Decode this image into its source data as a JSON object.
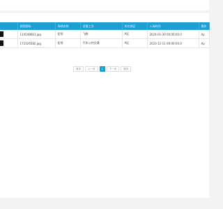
{
  "table": {
    "headers": [
      "",
      "视频图标",
      "场地名称",
      "设备工况",
      "所在病区",
      "入场时间",
      "操作"
    ],
    "rows": [
      [
        "",
        "114548661.jpg",
        "定坝",
        "飞跑",
        "A区",
        "2024-01-30 00:00:00.0",
        "Ap"
      ],
      [
        "",
        "172326582.jpg",
        "定坝",
        "汽车公共交通",
        "A区",
        "2023-12-11 00:00:00.0",
        "Ap"
      ]
    ]
  },
  "pager": {
    "first": "首页",
    "prev": "上一页",
    "current": "1",
    "next": "下一页",
    "last": "尾页"
  }
}
